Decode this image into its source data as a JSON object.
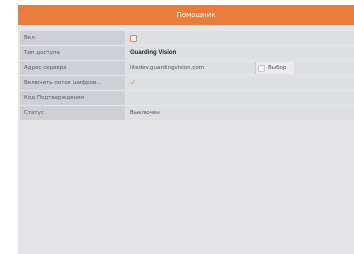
{
  "dialog": {
    "title": "Помощник"
  },
  "form": {
    "enable": {
      "label": "Вкл.",
      "checked": false
    },
    "access_type": {
      "label": "Тип доступа",
      "value": "Guarding Vision"
    },
    "server_address": {
      "label": "Адрес сервера",
      "value": "litedev.guardingvision.com",
      "select_label": "Выбор"
    },
    "stream_encryption": {
      "label": "Включить поток шифров...",
      "checked": true,
      "check_glyph": "✓"
    },
    "verification_code": {
      "label": "Код Подтверждения",
      "value": ""
    },
    "status": {
      "label": "Статус",
      "value": "Выключен"
    }
  },
  "colors": {
    "accent": "#ea7d3c",
    "panel_bg": "#e5e5e7",
    "label_bg": "#cfd0d5",
    "value_bg": "#dedfe3"
  }
}
